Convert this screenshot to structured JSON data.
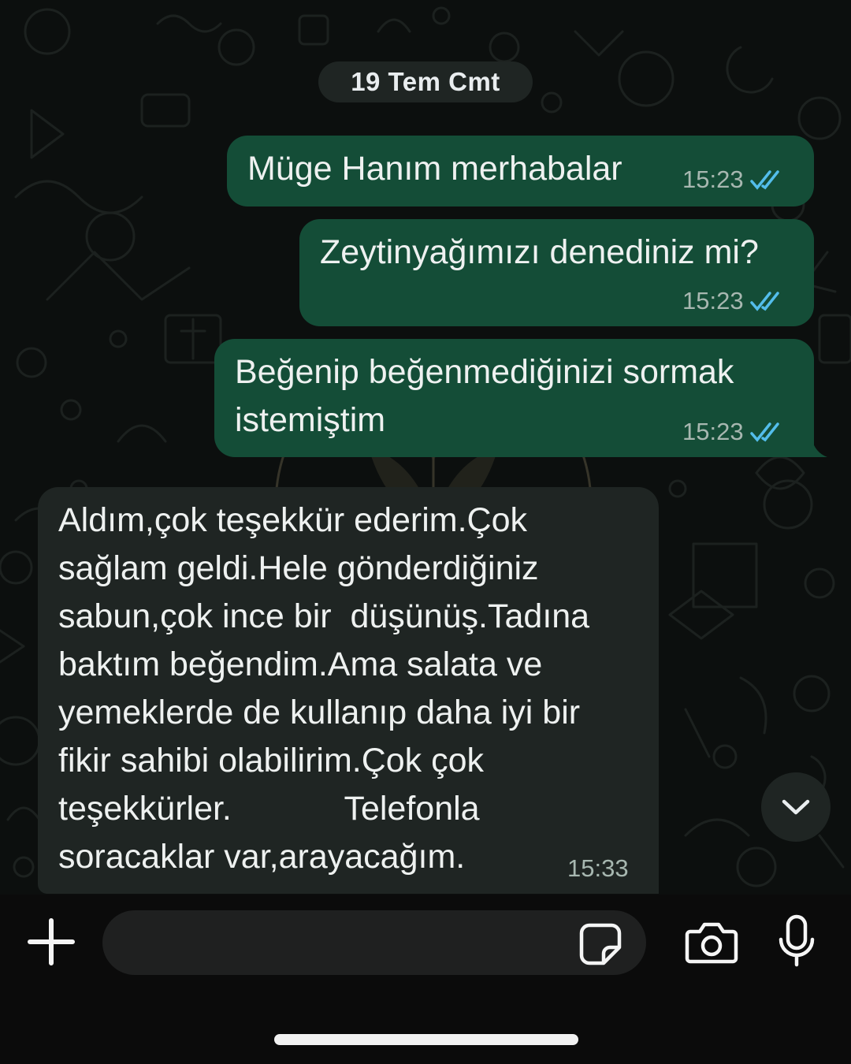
{
  "chat": {
    "date_label": "19 Tem Cmt",
    "messages": [
      {
        "direction": "outgoing",
        "text": "Müge Hanım merhabalar",
        "time": "15:23",
        "status": "read"
      },
      {
        "direction": "outgoing",
        "text": "Zeytinyağımızı denediniz mi?",
        "time": "15:23",
        "status": "read"
      },
      {
        "direction": "outgoing",
        "text": "Beğenip beğenmediğinizi sormak\nistemiştim",
        "time": "15:23",
        "status": "read"
      },
      {
        "direction": "incoming",
        "text": "Aldım,çok teşekkür ederim.Çok\nsağlam geldi.Hele gönderdiğiniz\nsabun,çok ince bir  düşünüş.Tadına\nbaktım beğendim.Ama salata ve\nyemeklerde de kullanıp daha iyi bir\nfikir sahibi olabilirim.Çok çok\nteşekkürler.            Telefonla\nsoracaklar var,arayacağım.",
        "time": "15:33"
      }
    ]
  },
  "colors": {
    "outgoing_bubble": "#144d37",
    "incoming_bubble": "#1f2523",
    "read_ticks": "#53bdeb"
  },
  "composer": {
    "placeholder": "",
    "icons": [
      "plus-icon",
      "sticker-icon",
      "camera-icon",
      "microphone-icon"
    ]
  },
  "scroll_button": {
    "icon": "chevron-down-icon"
  }
}
